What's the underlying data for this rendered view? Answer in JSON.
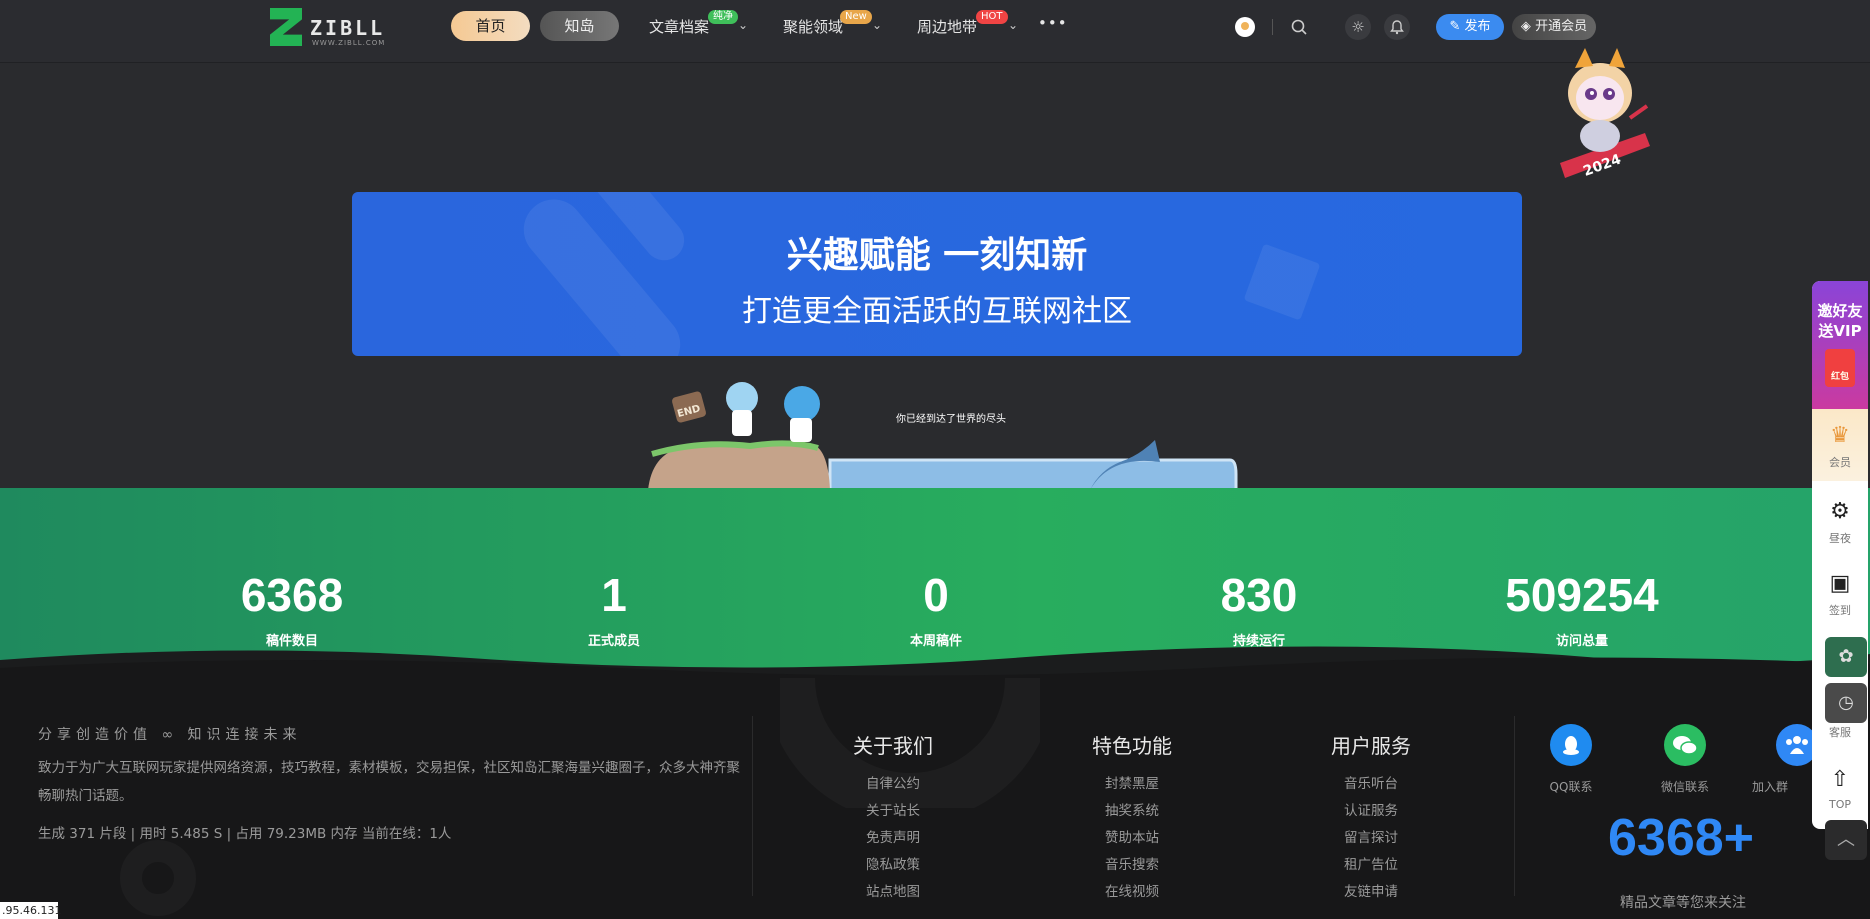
{
  "header": {
    "logo_word": "ZIBLL",
    "logo_sub": "WWW.ZIBLL.COM",
    "tabs": [
      {
        "label": "首页"
      },
      {
        "label": "知岛"
      }
    ],
    "nav": [
      {
        "label": "文章档案",
        "badge": "纯净",
        "badge_color": "#3fbf5a"
      },
      {
        "label": "聚能领域",
        "badge": "New",
        "badge_color": "#e8a64a"
      },
      {
        "label": "周边地带",
        "badge": "HOT",
        "badge_color": "#f04444"
      }
    ],
    "more": "•••",
    "publish_label": "发布",
    "vip_label": "开通会员"
  },
  "banner": {
    "title": "兴趣赋能 一刻知新",
    "subtitle": "打造更全面活跃的互联网社区"
  },
  "end_scene": {
    "sign": "END",
    "text": "你已经到达了世界的尽头"
  },
  "mascot": {
    "year": "2024"
  },
  "stats": [
    {
      "value": "6368",
      "label": "稿件数目"
    },
    {
      "value": "1",
      "label": "正式成员"
    },
    {
      "value": "0",
      "label": "本周稿件"
    },
    {
      "value": "830",
      "label": "持续运行"
    },
    {
      "value": "509254",
      "label": "访问总量"
    }
  ],
  "footer": {
    "slogan": "分享创造价值 ∞ 知识连接未来",
    "description": "致力于为广大互联网玩家提供网络资源，技巧教程，素材模板，交易担保，社区知岛汇聚海量兴趣圈子，众多大神齐聚畅聊热门话题。",
    "status_line": "生成 371 片段 | 用时 5.485 S | 占用 79.23MB 内存 当前在线：1人",
    "columns": [
      {
        "title": "关于我们",
        "links": [
          "自律公约",
          "关于站长",
          "免责声明",
          "隐私政策",
          "站点地图"
        ]
      },
      {
        "title": "特色功能",
        "links": [
          "封禁黑屋",
          "抽奖系统",
          "赞助本站",
          "音乐搜索",
          "在线视频"
        ]
      },
      {
        "title": "用户服务",
        "links": [
          "音乐听台",
          "认证服务",
          "留言探讨",
          "租广告位",
          "友链申请"
        ]
      }
    ],
    "social": [
      {
        "label": "QQ联系",
        "color": "#1f8bf0"
      },
      {
        "label": "微信联系",
        "color": "#2bbd62"
      },
      {
        "label": "加入群",
        "color": "#2f88f5"
      }
    ],
    "big_number": "6368+",
    "big_sub": "精品文章等您来关注"
  },
  "sidebar": {
    "promo_line1": "邀好友",
    "promo_line2": "送VIP",
    "promo_tag": "红包",
    "items": [
      {
        "label": "会员"
      },
      {
        "label": "昼夜"
      },
      {
        "label": "签到"
      },
      {
        "label": "客服"
      },
      {
        "label": "TOP"
      }
    ]
  },
  "ip_text": ".95.46.131"
}
